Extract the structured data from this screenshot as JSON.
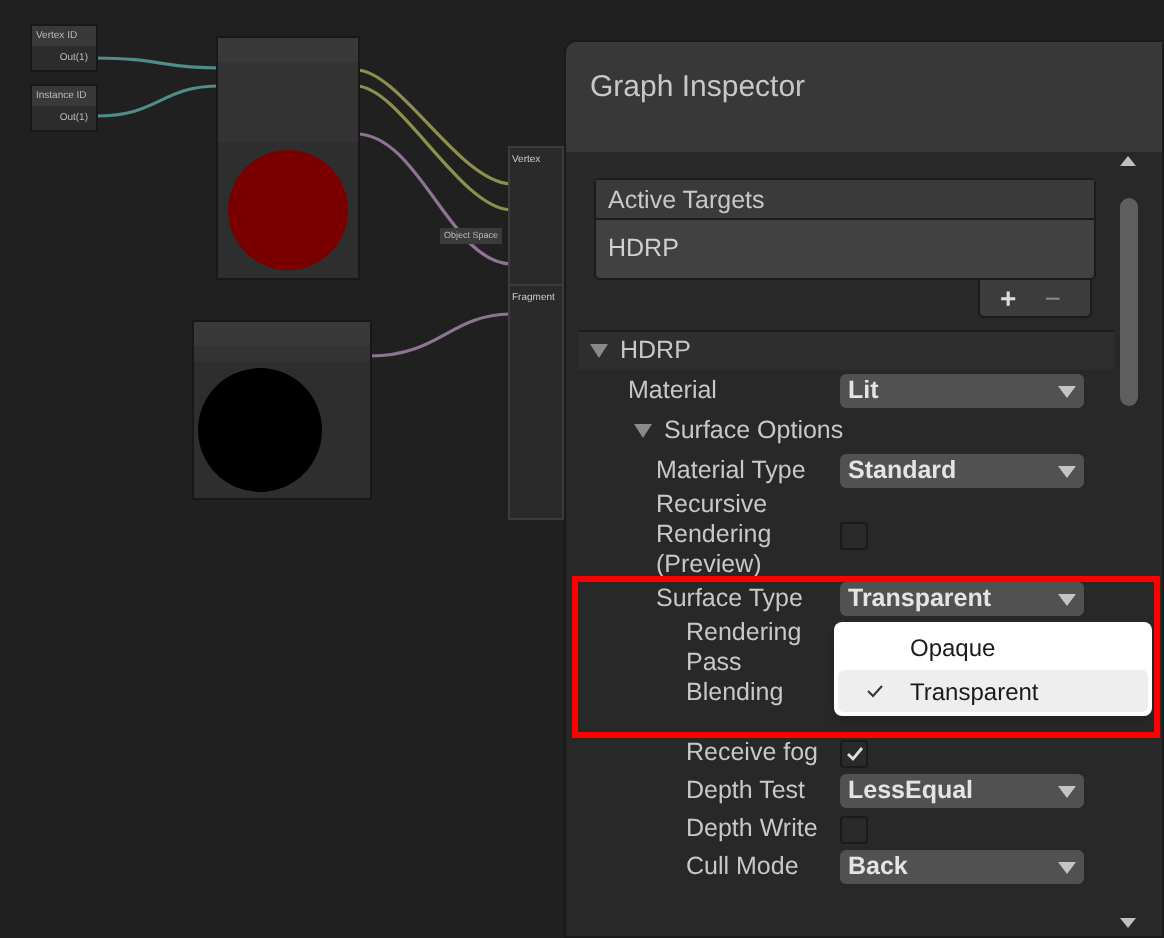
{
  "graph": {
    "nodes": [
      {
        "title": "Vertex ID",
        "port": "Out(1)"
      },
      {
        "title": "Instance ID",
        "port": "Out(1)"
      }
    ],
    "blocks": [
      {
        "title": "Vertex"
      },
      {
        "title": "Fragment"
      }
    ],
    "space_chip": "Object Space"
  },
  "inspector": {
    "title": "Graph Inspector",
    "active_targets": {
      "header": "Active Targets",
      "items": [
        "HDRP"
      ],
      "add": "+",
      "remove": "−"
    },
    "section": {
      "label": "HDRP",
      "expanded": true,
      "children": [
        {
          "kind": "dropdown",
          "label": "Material",
          "value": "Lit"
        },
        {
          "kind": "group",
          "label": "Surface Options",
          "expanded": true,
          "children": [
            {
              "kind": "dropdown",
              "label": "Material Type",
              "value": "Standard"
            },
            {
              "kind": "checkbox",
              "label": "Recursive Rendering (Preview)",
              "checked": false
            },
            {
              "kind": "dropdown",
              "label": "Surface Type",
              "value": "Transparent",
              "children": [
                {
                  "kind": "label",
                  "label": "Rendering Pass"
                },
                {
                  "kind": "label",
                  "label": "Blending"
                },
                {
                  "kind": "checkbox",
                  "label": "Receive fog",
                  "checked": true
                },
                {
                  "kind": "dropdown",
                  "label": "Depth Test",
                  "value": "LessEqual"
                },
                {
                  "kind": "checkbox",
                  "label": "Depth Write",
                  "checked": false
                },
                {
                  "kind": "dropdown",
                  "label": "Cull Mode",
                  "value": "Back"
                }
              ]
            }
          ]
        }
      ]
    },
    "popup": {
      "options": [
        {
          "label": "Opaque",
          "selected": false
        },
        {
          "label": "Transparent",
          "selected": true
        }
      ]
    }
  }
}
